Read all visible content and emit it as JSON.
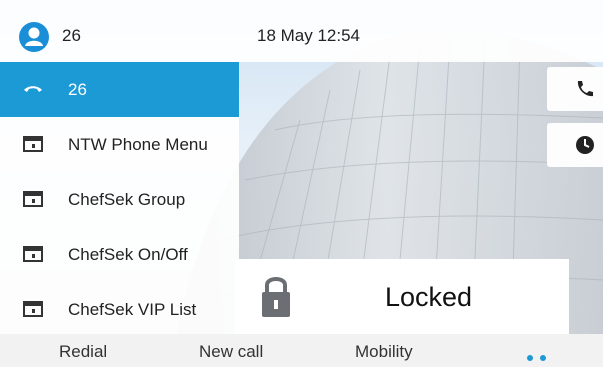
{
  "status_bar": {
    "extension": "26",
    "datetime": "18 May 12:54",
    "avatar_icon": "user-icon"
  },
  "lines": [
    {
      "label": "26",
      "icon": "handset-icon",
      "active": true
    },
    {
      "label": "NTW Phone Menu",
      "icon": "service-window-icon",
      "active": false
    },
    {
      "label": "ChefSek Group",
      "icon": "service-window-icon",
      "active": false
    },
    {
      "label": "ChefSek On/Off",
      "icon": "service-window-icon",
      "active": false
    },
    {
      "label": "ChefSek VIP List",
      "icon": "service-window-icon",
      "active": false
    }
  ],
  "side_buttons": [
    {
      "icon": "phone-icon"
    },
    {
      "icon": "clock-icon"
    }
  ],
  "popup": {
    "icon": "lock-icon",
    "text": "Locked"
  },
  "softkeys": {
    "redial": "Redial",
    "new_call": "New call",
    "mobility": "Mobility",
    "more_icon": "page-dots-icon"
  },
  "colors": {
    "accent": "#1c9ad6",
    "avatar": "#1a8fd8",
    "dot_active": "#1c9ad6",
    "dot_inactive": "#1c9ad6"
  }
}
